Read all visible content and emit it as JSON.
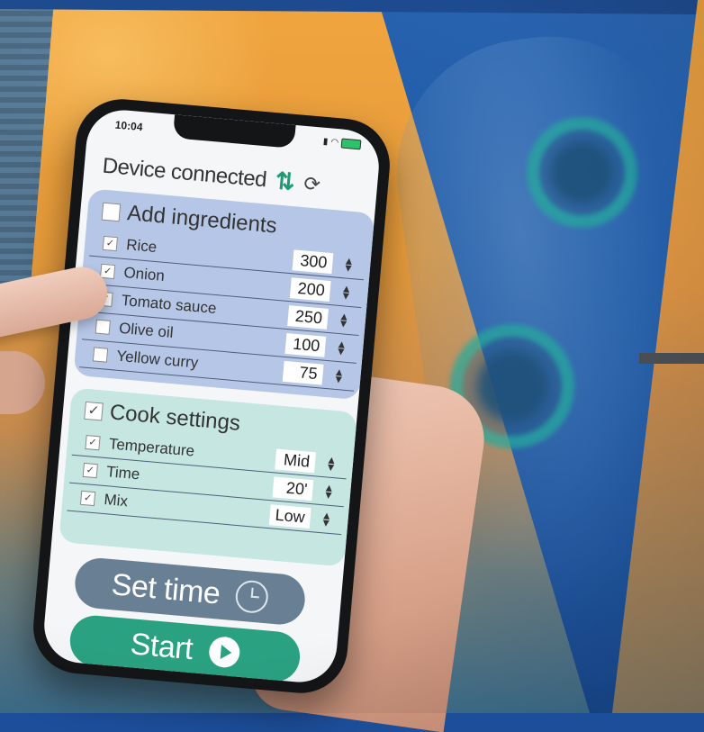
{
  "status_bar": {
    "time": "10:04"
  },
  "connection": {
    "label": "Device connected"
  },
  "ingredients": {
    "title": "Add ingredients",
    "items": [
      {
        "name": "Rice",
        "checked": true,
        "value": "300"
      },
      {
        "name": "Onion",
        "checked": true,
        "value": "200"
      },
      {
        "name": "Tomato sauce",
        "checked": true,
        "value": "250"
      },
      {
        "name": "Olive oil",
        "checked": false,
        "value": "100"
      },
      {
        "name": "Yellow curry",
        "checked": false,
        "value": "75"
      }
    ]
  },
  "cook_settings": {
    "title": "Cook settings",
    "items": [
      {
        "name": "Temperature",
        "checked": true,
        "value": "Mid"
      },
      {
        "name": "Time",
        "checked": true,
        "value": "20'"
      },
      {
        "name": "Mix",
        "checked": true,
        "value": "Low"
      }
    ]
  },
  "buttons": {
    "set_time": "Set time",
    "start": "Start"
  },
  "colors": {
    "ingredients_panel": "#b6c6e6",
    "cook_panel": "#c6e6e2",
    "set_time_button": "#687f94",
    "start_button": "#2aa282",
    "connection_arrows": "#1f9b74"
  },
  "icons": [
    "signal-icon",
    "wifi-icon",
    "battery-icon",
    "sync-arrows-icon",
    "refresh-icon",
    "stepper-icon",
    "clock-icon",
    "play-icon"
  ]
}
